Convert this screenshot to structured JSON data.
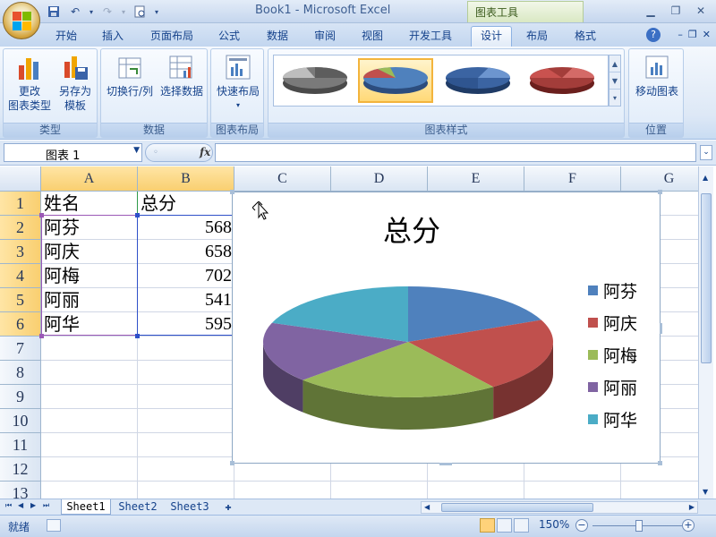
{
  "app": {
    "window_title": "Book1 - Microsoft Excel",
    "context_group": "图表工具"
  },
  "tabs": [
    {
      "label": "开始"
    },
    {
      "label": "插入"
    },
    {
      "label": "页面布局"
    },
    {
      "label": "公式"
    },
    {
      "label": "数据"
    },
    {
      "label": "审阅"
    },
    {
      "label": "视图"
    },
    {
      "label": "开发工具"
    },
    {
      "label": "设计"
    },
    {
      "label": "布局"
    },
    {
      "label": "格式"
    }
  ],
  "active_tab": "设计",
  "ribbon": {
    "groups": {
      "type": "类型",
      "data": "数据",
      "layout": "图表布局",
      "styles": "图表样式",
      "location": "位置"
    },
    "buttons": {
      "change_type_1": "更改",
      "change_type_2": "图表类型",
      "save_template_1": "另存为",
      "save_template_2": "模板",
      "switch_row_col": "切换行/列",
      "select_data": "选择数据",
      "quick_layout": "快速布局",
      "move_chart": "移动图表"
    }
  },
  "formula_bar": {
    "name_box": "图表 1",
    "fx": "fx",
    "content": ""
  },
  "columns": [
    "A",
    "B",
    "C",
    "D",
    "E",
    "F",
    "G"
  ],
  "rows": [
    "1",
    "2",
    "3",
    "4",
    "5",
    "6",
    "7",
    "8",
    "9",
    "10",
    "11",
    "12",
    "13"
  ],
  "cells": {
    "A1": "姓名",
    "B1": "总分",
    "A2": "阿芬",
    "B2": "568",
    "A3": "阿庆",
    "B3": "658",
    "A4": "阿梅",
    "B4": "702",
    "A5": "阿丽",
    "B5": "541",
    "A6": "阿华",
    "B6": "595"
  },
  "chart": {
    "title": "总分",
    "type": "pie-3d",
    "colors": [
      "#4f81bd",
      "#c0504d",
      "#9bbb59",
      "#8064a2",
      "#4bacc6"
    ],
    "legend": [
      {
        "label": "阿芬"
      },
      {
        "label": "阿庆"
      },
      {
        "label": "阿梅"
      },
      {
        "label": "阿丽"
      },
      {
        "label": "阿华"
      }
    ]
  },
  "chart_data": {
    "type": "pie",
    "title": "总分",
    "categories": [
      "阿芬",
      "阿庆",
      "阿梅",
      "阿丽",
      "阿华"
    ],
    "values": [
      568,
      658,
      702,
      541,
      595
    ],
    "legend_position": "right"
  },
  "sheets": [
    {
      "label": "Sheet1"
    },
    {
      "label": "Sheet2"
    },
    {
      "label": "Sheet3"
    }
  ],
  "active_sheet": "Sheet1",
  "status": {
    "text": "就绪",
    "zoom": "150%"
  }
}
